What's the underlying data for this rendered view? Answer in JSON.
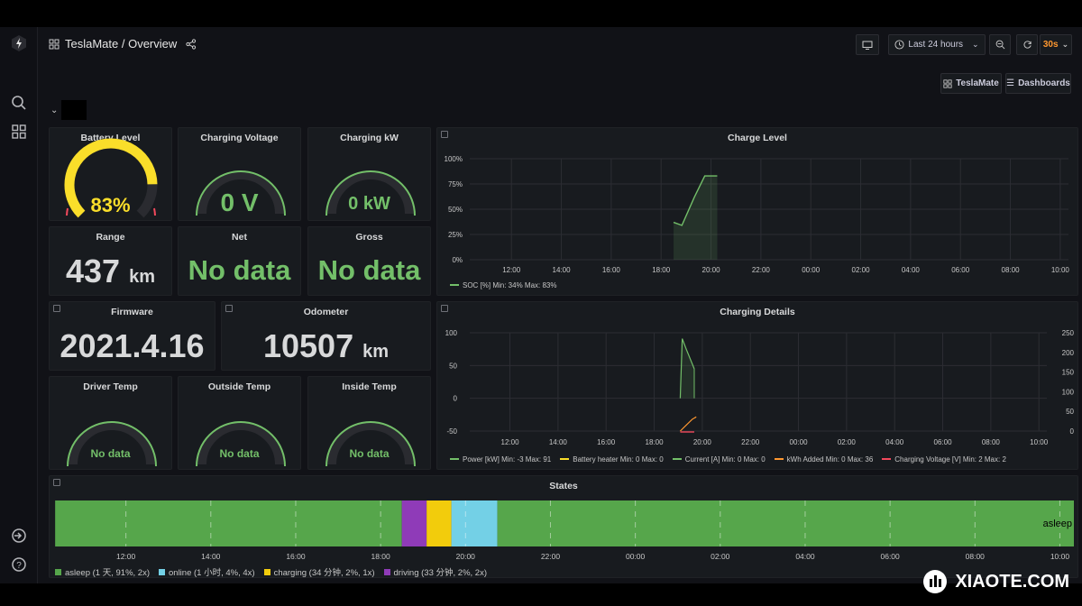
{
  "header": {
    "title": "TeslaMate / Overview",
    "time_range": "Last 24 hours",
    "refresh": "30s",
    "link_teslamate": "TeslaMate",
    "link_dashboards": "Dashboards",
    "variable_caret": "⌄"
  },
  "stats": {
    "battery_level": {
      "title": "Battery Level",
      "value": "83%",
      "percent": 83
    },
    "charging_voltage": {
      "title": "Charging Voltage",
      "value": "0 V"
    },
    "charging_kw": {
      "title": "Charging kW",
      "value": "0 kW"
    },
    "range": {
      "title": "Range",
      "value": "437",
      "unit": "km"
    },
    "net": {
      "title": "Net",
      "value": "No data"
    },
    "gross": {
      "title": "Gross",
      "value": "No data"
    },
    "firmware": {
      "title": "Firmware",
      "value": "2021.4.16"
    },
    "odometer": {
      "title": "Odometer",
      "value": "10507",
      "unit": "km"
    },
    "driver_temp": {
      "title": "Driver Temp",
      "value": "No data"
    },
    "outside_temp": {
      "title": "Outside Temp",
      "value": "No data"
    },
    "inside_temp": {
      "title": "Inside Temp",
      "value": "No data"
    }
  },
  "colors": {
    "green": "#73bf69",
    "yellow": "#fade2a",
    "red": "#f2495c",
    "orange": "#ff9830",
    "blue": "#73d0e6",
    "purple": "#8f3bb8"
  },
  "chart_data": [
    {
      "type": "area",
      "title": "Charge Level",
      "x_ticks": [
        "12:00",
        "14:00",
        "16:00",
        "18:00",
        "20:00",
        "22:00",
        "00:00",
        "02:00",
        "04:00",
        "06:00",
        "08:00",
        "10:00"
      ],
      "y_ticks": [
        "100%",
        "75%",
        "50%",
        "25%",
        "0%"
      ],
      "ylim": [
        0,
        100
      ],
      "series": [
        {
          "name": "SOC [%]",
          "x": [
            "18:30",
            "18:50",
            "19:20",
            "19:45",
            "20:15"
          ],
          "values": [
            37,
            34,
            62,
            83,
            83
          ]
        }
      ],
      "legend": "SOC [%]  Min: 34%  Max: 83%"
    },
    {
      "type": "line",
      "title": "Charging Details",
      "x_ticks": [
        "12:00",
        "14:00",
        "16:00",
        "18:00",
        "20:00",
        "22:00",
        "00:00",
        "02:00",
        "04:00",
        "06:00",
        "08:00",
        "10:00"
      ],
      "y_ticks_left": [
        "100",
        "50",
        "0",
        "-50"
      ],
      "y_ticks_right": [
        "250",
        "200",
        "150",
        "100",
        "50",
        "0"
      ],
      "ylim_left": [
        -50,
        100
      ],
      "ylim_right": [
        0,
        250
      ],
      "series": [
        {
          "name": "Power [kW]",
          "x": [
            "19:05",
            "19:10",
            "19:20",
            "19:30",
            "19:40"
          ],
          "values": [
            0,
            91,
            75,
            60,
            45
          ]
        },
        {
          "name": "kWh Added",
          "x": [
            "19:05",
            "19:20",
            "19:35",
            "19:45"
          ],
          "values": [
            0,
            15,
            30,
            36
          ]
        }
      ],
      "legend": [
        {
          "label": "Power [kW]",
          "stats": "Min: -3   Max: 91",
          "color": "#73bf69"
        },
        {
          "label": "Battery heater",
          "stats": "Min: 0   Max: 0",
          "color": "#fade2a"
        },
        {
          "label": "Current [A]",
          "stats": "Min: 0   Max: 0",
          "color": "#73bf69"
        },
        {
          "label": "kWh Added",
          "stats": "Min: 0   Max: 36",
          "color": "#ff9830"
        },
        {
          "label": "Charging Voltage [V]",
          "stats": "Min: 2   Max: 2",
          "color": "#f2495c"
        }
      ]
    },
    {
      "type": "bar",
      "title": "States",
      "x_ticks": [
        "12:00",
        "14:00",
        "16:00",
        "18:00",
        "20:00",
        "22:00",
        "00:00",
        "02:00",
        "04:00",
        "06:00",
        "08:00",
        "10:00"
      ],
      "segments": [
        {
          "state": "asleep",
          "start": "10:20",
          "end": "18:30",
          "color": "#56a64b"
        },
        {
          "state": "driving",
          "start": "18:30",
          "end": "19:05",
          "color": "#8f3bb8"
        },
        {
          "state": "charging",
          "start": "19:05",
          "end": "19:40",
          "color": "#f2cc0c"
        },
        {
          "state": "online",
          "start": "19:40",
          "end": "20:45",
          "color": "#73d0e6"
        },
        {
          "state": "asleep",
          "start": "20:45",
          "end": "10:20",
          "color": "#56a64b"
        }
      ],
      "current_state": "asleep",
      "legend": [
        {
          "label": "asleep (1 天, 91%, 2x)",
          "color": "#56a64b"
        },
        {
          "label": "online (1 小时, 4%, 4x)",
          "color": "#73d0e6"
        },
        {
          "label": "charging (34 分钟, 2%, 1x)",
          "color": "#f2cc0c"
        },
        {
          "label": "driving (33 分钟, 2%, 2x)",
          "color": "#8f3bb8"
        }
      ]
    }
  ],
  "watermark": "XIAOTE.COM"
}
